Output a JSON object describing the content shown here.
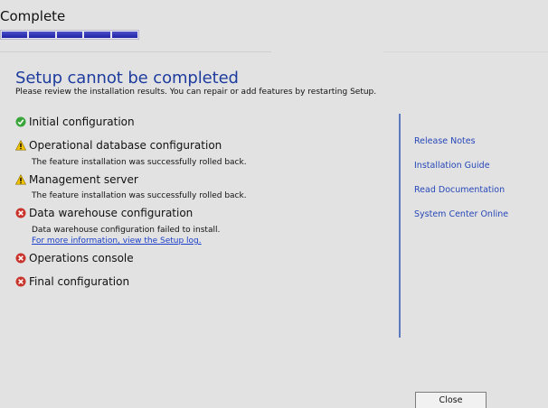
{
  "header": {
    "title": "Complete",
    "progress_fraction": 1.0,
    "progress_color": "#2a2fb0"
  },
  "main": {
    "title": "Setup cannot be completed",
    "subtitle": "Please review the installation results.  You can repair or add features by restarting Setup.",
    "title_color": "#1e3c9e"
  },
  "items": [
    {
      "label": "Initial configuration",
      "status": "success",
      "icon": "check-icon"
    },
    {
      "label": "Operational database configuration",
      "status": "warning",
      "icon": "warning-icon",
      "note": "The feature installation was successfully rolled back."
    },
    {
      "label": "Management server",
      "status": "warning",
      "icon": "warning-icon",
      "note": "The feature installation was successfully rolled back."
    },
    {
      "label": "Data warehouse configuration",
      "status": "error",
      "icon": "error-icon",
      "note": "Data warehouse configuration failed to install.",
      "link": "For more information, view the Setup log."
    },
    {
      "label": "Operations console",
      "status": "error",
      "icon": "error-icon"
    },
    {
      "label": "Final configuration",
      "status": "error",
      "icon": "error-icon"
    }
  ],
  "sidebar": {
    "links": [
      "Release Notes",
      "Installation Guide",
      "Read Documentation",
      "System Center Online"
    ]
  },
  "footer": {
    "close_label": "Close"
  },
  "colors": {
    "success": "#3aa53a",
    "warning": "#f2c200",
    "error": "#c8342c",
    "link": "#2647b8"
  }
}
